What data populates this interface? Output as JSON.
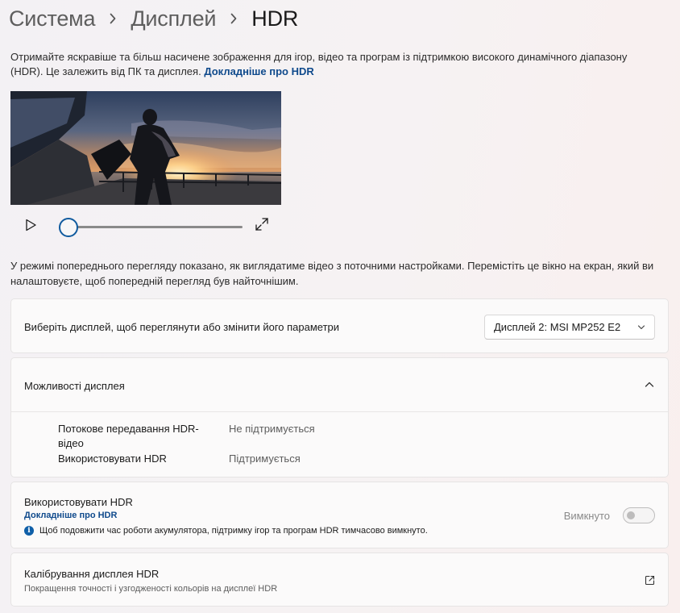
{
  "breadcrumb": {
    "items": [
      "Система",
      "Дисплей"
    ],
    "current": "HDR"
  },
  "intro": {
    "text": "Отримайте яскравіше та більш насичене зображення для ігор, відео та програм із підтримкою високого динамічного діапазону (HDR). Це залежить від ПК та дисплея.",
    "link": "Докладніше про HDR"
  },
  "player": {
    "progress": 0
  },
  "preview_note": "У режимі попереднього перегляду показано, як виглядатиме відео з поточними настройками. Перемістіть це вікно на екран, який ви налаштовуєте, щоб попередній перегляд був найточнішим.",
  "display_select": {
    "label": "Виберіть дисплей, щоб переглянути або змінити його параметри",
    "value": "Дисплей 2: MSI MP252 E2"
  },
  "capabilities": {
    "title": "Можливості дисплея",
    "rows": [
      {
        "label": "Потокове передавання HDR-відео",
        "value": "Не підтримується"
      },
      {
        "label": "Використовувати HDR",
        "value": "Підтримується"
      }
    ]
  },
  "use_hdr": {
    "title": "Використовувати HDR",
    "link": "Докладніше про HDR",
    "toggle_label": "Вимкнуто",
    "toggle_on": false,
    "info": "Щоб подовжити час роботи акумулятора, підтримку ігор та програм HDR тимчасово вимкнуто."
  },
  "calibration": {
    "title": "Калібрування дисплея HDR",
    "subtitle": "Покращення точності і узгодженості кольорів на дисплеї HDR"
  },
  "colors": {
    "accent": "#0f4a8c",
    "page_bg": "#f4f1f3",
    "card_bg": "#fbfafa"
  }
}
